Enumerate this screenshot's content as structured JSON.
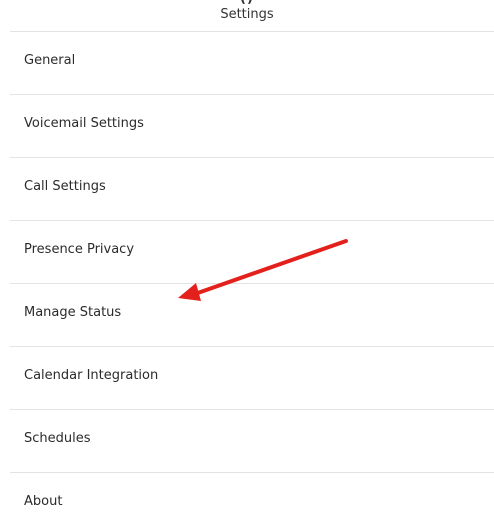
{
  "header": {
    "top_glyph": "()",
    "title": "Settings"
  },
  "menu": {
    "items": [
      {
        "label": "General"
      },
      {
        "label": "Voicemail Settings"
      },
      {
        "label": "Call Settings"
      },
      {
        "label": "Presence Privacy"
      },
      {
        "label": "Manage Status"
      },
      {
        "label": "Calendar Integration"
      },
      {
        "label": "Schedules"
      },
      {
        "label": "About"
      }
    ]
  },
  "annotation": {
    "arrow_color": "#e3201b",
    "arrow_target": "Manage Status"
  }
}
